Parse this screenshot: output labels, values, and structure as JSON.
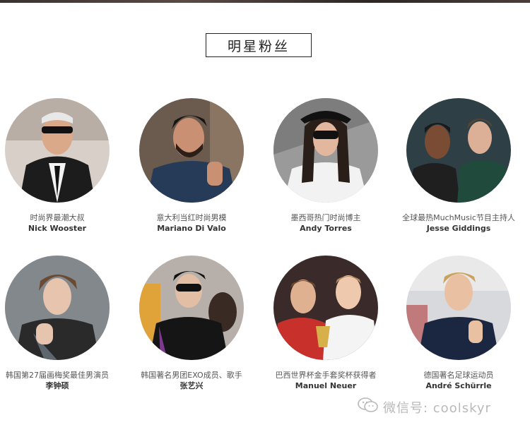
{
  "section": {
    "title": "明星粉丝"
  },
  "fans": [
    {
      "desc": "时尚界最潮大叔",
      "name": "Nick Wooster",
      "bg": "#d8cfc8",
      "fg": "#1c1c1c"
    },
    {
      "desc": "意大利当红时尚男模",
      "name": "Mariano Di Valo",
      "bg": "#6b5a4e",
      "fg": "#263b58"
    },
    {
      "desc": "墨西哥热门时尚博主",
      "name": "Andy Torres",
      "bg": "#9a9a9a",
      "fg": "#f2f2f2"
    },
    {
      "desc": "全球最热MuchMusic节目主持人",
      "name": "Jesse Giddings",
      "bg": "#2f3f46",
      "fg": "#1f4a3c"
    },
    {
      "desc": "韩国第27届画梅奖最佳男演员",
      "name": "李钟硕",
      "bg": "#7a7f84",
      "fg": "#2a2a2a"
    },
    {
      "desc": "韩国著名男团EXO成员、歌手",
      "name": "张艺兴",
      "bg": "#b7b0aa",
      "fg": "#151515"
    },
    {
      "desc": "巴西世界杯金手套奖杯获得者",
      "name": "Manuel Neuer",
      "bg": "#3b2a2a",
      "fg": "#c8312b"
    },
    {
      "desc": "德国著名足球运动员",
      "name": "André Schürrle",
      "bg": "#e9e9ea",
      "fg": "#1b2740"
    }
  ],
  "watermark": {
    "text": "微信号: coolskyr",
    "icon": "wechat-icon"
  }
}
